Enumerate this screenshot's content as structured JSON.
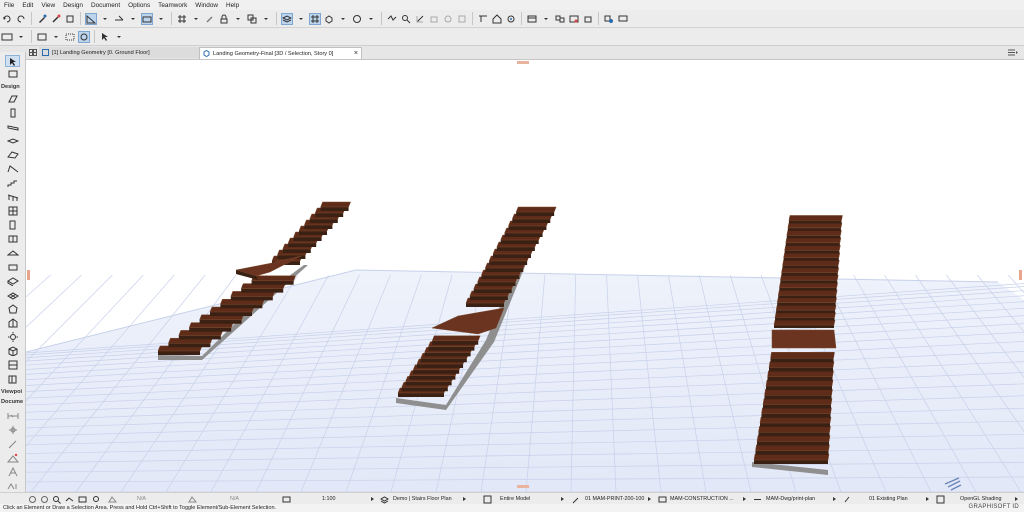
{
  "menu": [
    "File",
    "Edit",
    "View",
    "Design",
    "Document",
    "Options",
    "Teamwork",
    "Window",
    "Help"
  ],
  "tabs": {
    "floor_plan": "[1] Landing Geometry [0. Ground Floor]",
    "view_3d": "Landing Geometry-Final [3D / Selection, Story 0]",
    "close_glyph": "×"
  },
  "toolbox": {
    "design_label": "Design",
    "viewpoint_label": "Viewpoi",
    "document_label": "Docume"
  },
  "status": {
    "angle_1": "N/A",
    "angle_2": "N/A",
    "scale": "1:100",
    "layer_combo": "Demo | Stairs Floor Plan",
    "model_view": "Entire Model",
    "pen_set": "01 MAM-PRINT-200-100",
    "mvo": "MAM-CONSTRUCTION ...",
    "dimension": "MAM-Dwg/print-plan",
    "renovation": "01 Existing Plan",
    "shading": "OpenGL Shading"
  },
  "hint": "Click an Element or Draw a Selection Area. Press and Hold Ctrl+Shift to Toggle Element/Sub-Element Selection.",
  "brand": "GRAPHISOFT ID",
  "colors": {
    "accent": "#2b6cb0",
    "tread": "#5e2c18",
    "tread_edge": "#8f5a3a",
    "grid_line": "#c7d1ea"
  }
}
